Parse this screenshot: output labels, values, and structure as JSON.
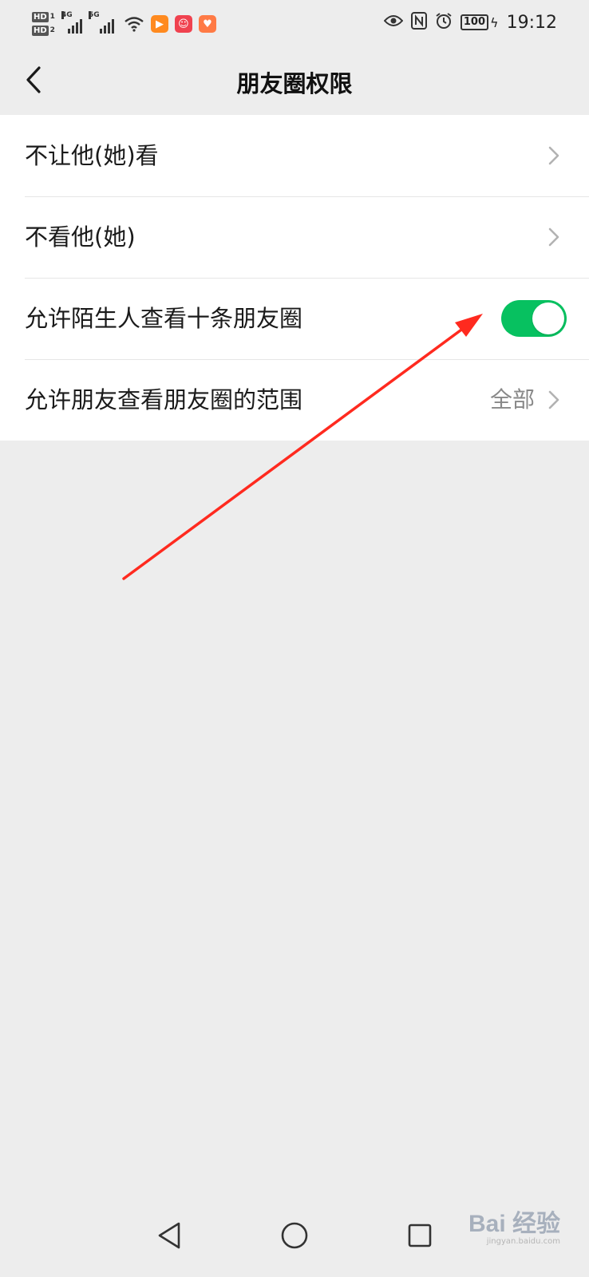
{
  "status_bar": {
    "sim1_label": "HD",
    "sim1_index": "1",
    "sim2_label": "HD",
    "sim2_index": "2",
    "net1": "4G",
    "net2": "5G",
    "battery": "100",
    "time": "19:12",
    "icons": [
      "signal-icon",
      "wifi-icon",
      "video-app-icon",
      "music-app-icon",
      "health-app-icon",
      "eye-icon",
      "nfc-icon",
      "alarm-icon",
      "battery-icon",
      "charging-icon"
    ]
  },
  "nav": {
    "title": "朋友圈权限",
    "back_icon": "back-chevron-icon"
  },
  "settings": {
    "items": [
      {
        "label": "不让他(她)看",
        "control": "chevron"
      },
      {
        "label": "不看他(她)",
        "control": "chevron"
      },
      {
        "label": "允许陌生人查看十条朋友圈",
        "control": "toggle",
        "toggle_on": true
      },
      {
        "label": "允许朋友查看朋友圈的范围",
        "value": "全部",
        "control": "chevron"
      }
    ]
  },
  "annotation": {
    "type": "arrow",
    "color": "#ff2a1f"
  },
  "system_nav": {
    "icons": [
      "back-triangle-icon",
      "home-circle-icon",
      "recents-square-icon"
    ]
  },
  "watermark": {
    "text": "Bai 经验",
    "sub": "jingyan.baidu.com"
  },
  "colors": {
    "background": "#ededed",
    "toggle_on": "#07c160",
    "annotation_arrow": "#ff2a1f"
  }
}
